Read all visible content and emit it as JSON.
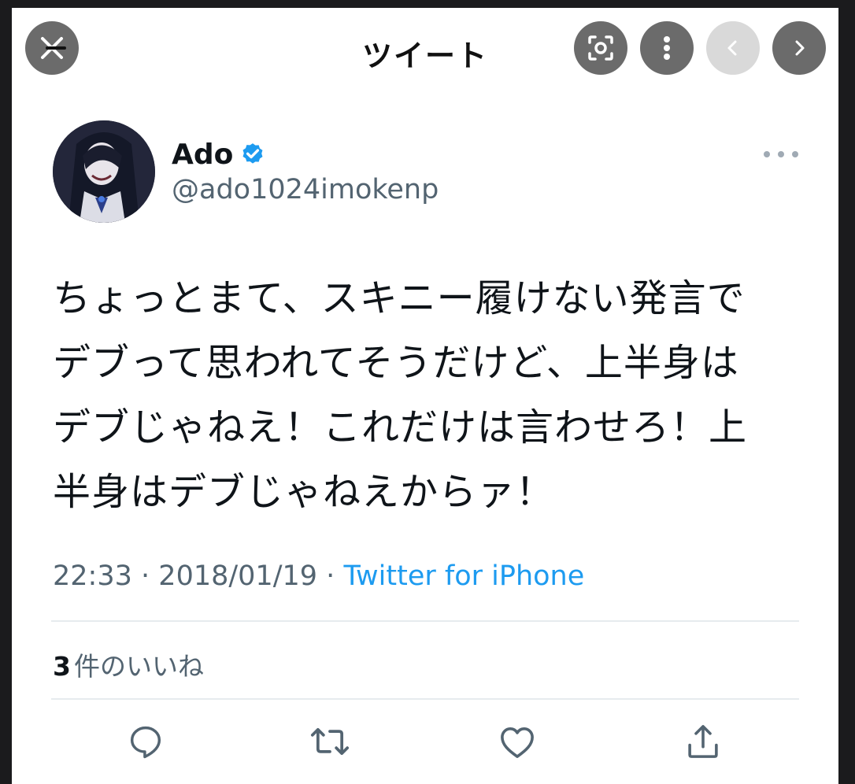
{
  "header": {
    "title": "ツイート",
    "close_icon": "close-icon",
    "lens_icon": "lens-icon",
    "menu_icon": "vertical-dots-icon",
    "prev_icon": "chevron-left-icon",
    "next_icon": "chevron-right-icon"
  },
  "tweet": {
    "display_name": "Ado",
    "verified": true,
    "handle": "@ado1024imokenp",
    "text": "ちょっとまて、スキニー履けない発言で\nデブって思われてそうだけど、上半身は\nデブじゃねえ！これだけは言わせろ！上\n半身はデブじゃねえからァ！",
    "time": "22:33",
    "date": "2018/01/19",
    "separator": "·",
    "source": "Twitter for iPhone",
    "likes_count": "3",
    "likes_label": "件のいいね"
  },
  "colors": {
    "accent": "#1d9bf0",
    "secondary_text": "#536471",
    "primary_text": "#0f1419"
  },
  "actions": [
    "reply-icon",
    "retweet-icon",
    "like-icon",
    "share-icon"
  ]
}
